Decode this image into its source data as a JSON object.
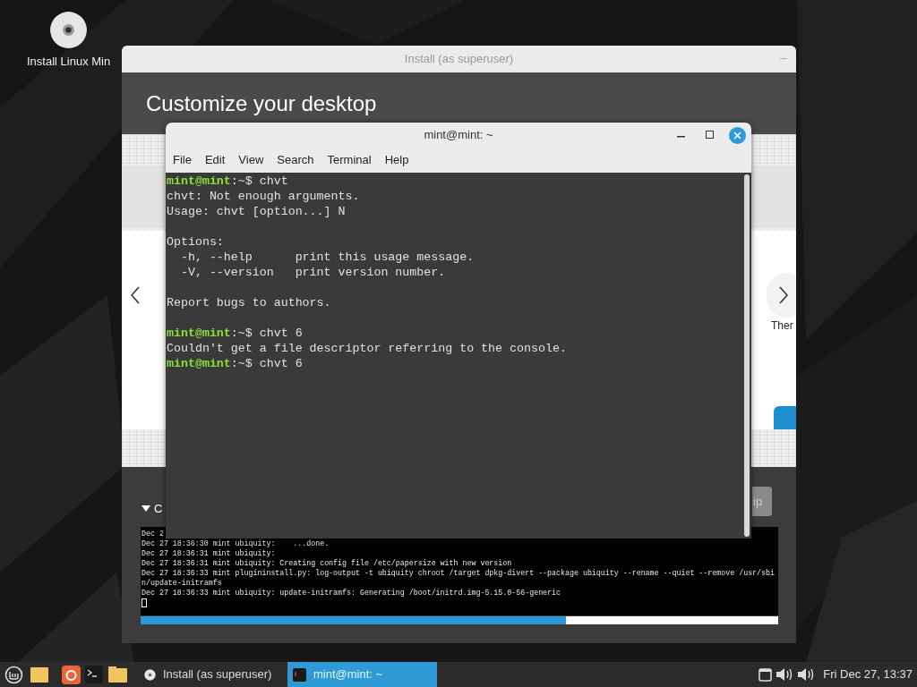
{
  "desktop": {
    "icons": [
      {
        "label": "Install Linux Min"
      }
    ]
  },
  "installer": {
    "title": "Install (as superuser)",
    "heading": "Customize your desktop",
    "theme_label": "Ther",
    "details_toggle": "C",
    "skip_button": "ip",
    "log_lines": [
      "Dec 2",
      "Dec 27 18:36:30 mint ubiquity:    ...done.",
      "Dec 27 18:36:31 mint ubiquity:",
      "Dec 27 18:36:31 mint ubiquity: Creating config file /etc/papersize with new version",
      "Dec 27 18:36:33 mint plugininstall.py: log-output -t ubiquity chroot /target dpkg-divert --package ubiquity --rename --quiet --remove /usr/sbi",
      "n/update-initramfs",
      "Dec 27 18:36:33 mint ubiquity: update-initramfs: Generating /boot/initrd.img-5.15.0-56-generic"
    ],
    "progress": {
      "level": 0.667
    }
  },
  "terminal": {
    "title": "mint@mint: ~",
    "menu": [
      "File",
      "Edit",
      "View",
      "Search",
      "Terminal",
      "Help"
    ],
    "lines": [
      {
        "kind": "prompt",
        "user": "mint@mint",
        "rest": ":~$ chvt"
      },
      {
        "kind": "output",
        "text": "chvt: Not enough arguments."
      },
      {
        "kind": "output",
        "text": "Usage: chvt [option...] N"
      },
      {
        "kind": "blank"
      },
      {
        "kind": "output",
        "text": "Options:"
      },
      {
        "kind": "output",
        "text": "  -h, --help      print this usage message."
      },
      {
        "kind": "output",
        "text": "  -V, --version   print version number."
      },
      {
        "kind": "blank"
      },
      {
        "kind": "output",
        "text": "Report bugs to authors."
      },
      {
        "kind": "blank"
      },
      {
        "kind": "prompt",
        "user": "mint@mint",
        "rest": ":~$ chvt 6"
      },
      {
        "kind": "output",
        "text": "Couldn't get a file descriptor referring to the console."
      },
      {
        "kind": "prompt",
        "user": "mint@mint",
        "rest": ":~$ chvt 6"
      }
    ]
  },
  "taskbar": {
    "tasks": [
      {
        "label": "Install (as superuser)",
        "selected": false
      },
      {
        "label": "mint@mint: ~",
        "selected": true
      }
    ],
    "clock": "Fri Dec 27, 13:37"
  }
}
